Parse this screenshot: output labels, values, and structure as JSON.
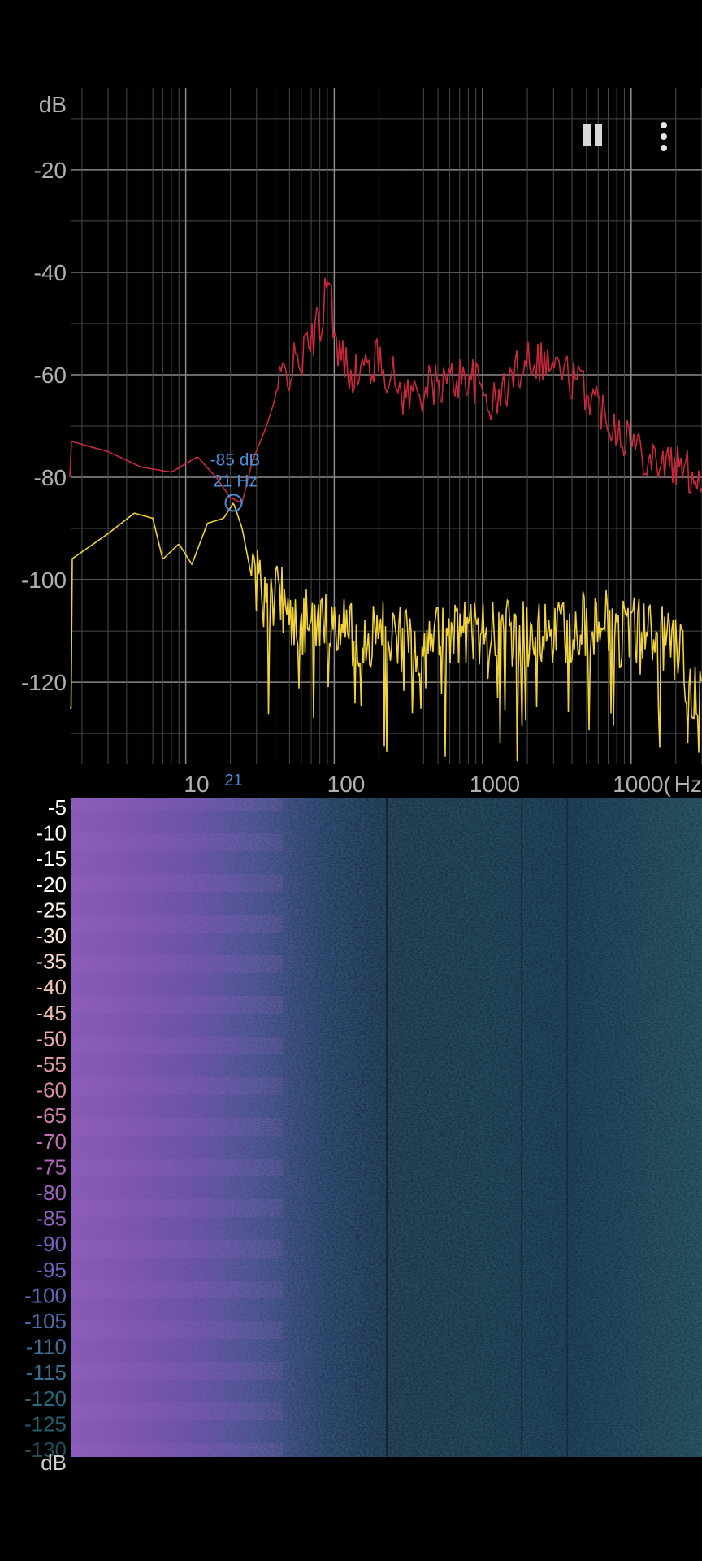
{
  "spectrum": {
    "y_axis_unit": "dB",
    "y_ticks": [
      "-20",
      "-40",
      "-60",
      "-80",
      "-100",
      "-120"
    ],
    "x_ticks": [
      "10",
      "100",
      "1000",
      "1000("
    ],
    "x_axis_unit": "Hz",
    "xlim": [
      1.7,
      30000
    ],
    "ylim": [
      -136,
      -4
    ],
    "marker": {
      "db_label": "-85 dB",
      "hz_label": "21 Hz",
      "axis_label": "21",
      "freq": 21,
      "db": -85,
      "color": "#4a90d9"
    },
    "series_colors": {
      "peak": "#c8283c",
      "current": "#f0d23c"
    }
  },
  "spectrogram": {
    "y_ticks": [
      "-5",
      "-10",
      "-15",
      "-20",
      "-25",
      "-30",
      "-35",
      "-40",
      "-45",
      "-50",
      "-55",
      "-60",
      "-65",
      "-70",
      "-75",
      "-80",
      "-85",
      "-90",
      "-95",
      "-100",
      "-105",
      "-110",
      "-115",
      "-120",
      "-125",
      "-130"
    ],
    "y_axis_unit": "dB",
    "tick_colors": [
      "#ffffff",
      "#ffffff",
      "#ffffff",
      "#ffffff",
      "#fff6ee",
      "#ffe8d6",
      "#f9d7c2",
      "#f2c8b2",
      "#eebcac",
      "#e8aaa8",
      "#e29aa8",
      "#da8aaa",
      "#cf7cb0",
      "#c070b6",
      "#b068ba",
      "#9f63bf",
      "#9060c0",
      "#7e60c0",
      "#6c64c0",
      "#5c68b8",
      "#4d6cac",
      "#3f6ea0",
      "#33708f",
      "#2b6a7c",
      "#245f6a",
      "#1f4f55"
    ]
  },
  "controls": {
    "pause": "pause-icon",
    "more": "more-vert-icon"
  }
}
